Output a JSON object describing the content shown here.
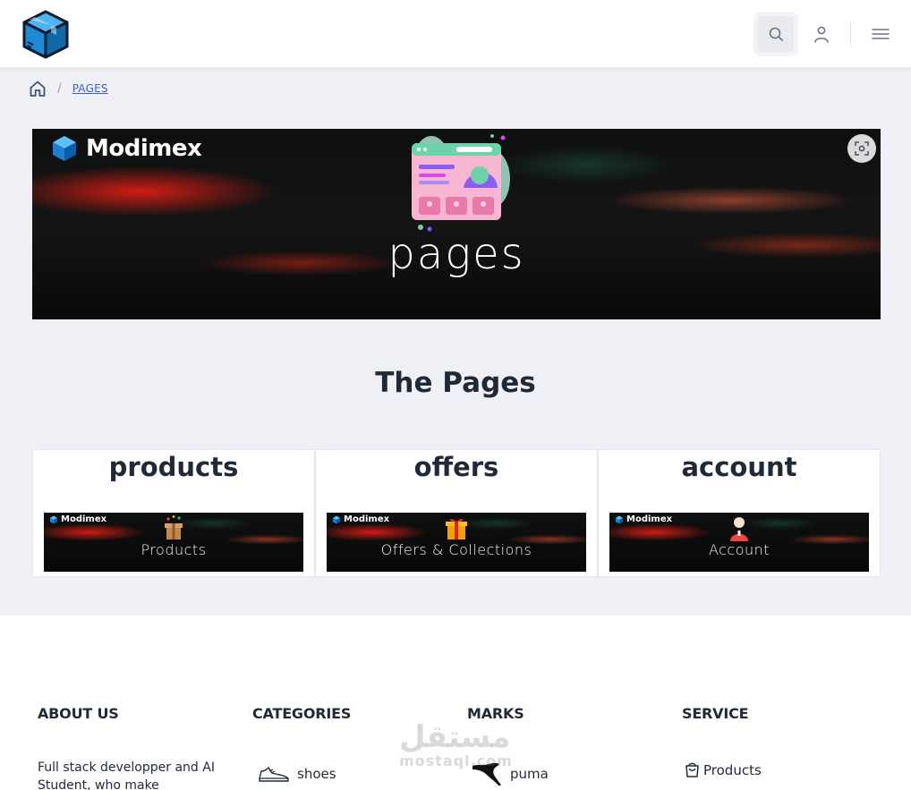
{
  "header": {
    "logo_icon": "cube-box-icon",
    "search_icon": "search-icon",
    "user_icon": "user-icon",
    "menu_icon": "hamburger-menu-icon"
  },
  "breadcrumb": {
    "home_icon": "home-icon",
    "separator": "/",
    "current": "PAGES"
  },
  "banner": {
    "brand": "Modimex",
    "title": "pages",
    "scan_icon": "scan-icon"
  },
  "section": {
    "title": "The Pages"
  },
  "cards": [
    {
      "title": "products",
      "brand": "Modimex",
      "image_label": "Products",
      "icon": "gift-box-icon"
    },
    {
      "title": "offers",
      "brand": "Modimex",
      "image_label": "Offers & Collections",
      "icon": "present-icon"
    },
    {
      "title": "account",
      "brand": "Modimex",
      "image_label": "Account",
      "icon": "person-icon"
    }
  ],
  "footer": {
    "about": {
      "heading": "ABOUT US",
      "text": "Full stack developper and AI Student, who make"
    },
    "categories": {
      "heading": "CATEGORIES",
      "items": [
        {
          "label": "shoes",
          "icon": "shoe-icon"
        }
      ]
    },
    "marks": {
      "heading": "MARKS",
      "items": [
        {
          "label": "puma",
          "icon": "puma-logo-icon"
        }
      ]
    },
    "service": {
      "heading": "SERVICE",
      "items": [
        {
          "label": "Products",
          "icon": "shopping-bag-icon"
        }
      ]
    }
  },
  "watermark": {
    "arabic": "مستقل",
    "latin": "mostaql.com"
  },
  "colors": {
    "page_bg": "#eef0f6",
    "link": "#3b5bdb",
    "heading": "#1f2937"
  }
}
